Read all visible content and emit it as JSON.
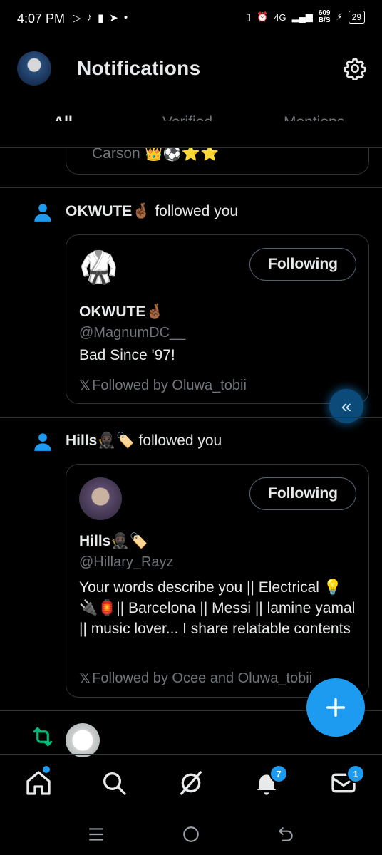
{
  "status_bar": {
    "time": "4:07 PM",
    "network": "4G",
    "speed": "609",
    "speed_unit": "B/S",
    "battery": "29"
  },
  "header": {
    "title": "Notifications"
  },
  "tabs": [
    {
      "label": "All",
      "active": true
    },
    {
      "label": "Verified",
      "active": false
    },
    {
      "label": "Mentions",
      "active": false
    }
  ],
  "partial_card": {
    "text": "Carson 👑⚽⭐⭐"
  },
  "notifications": [
    {
      "actor": "OKWUTE🤞🏾",
      "action": "followed you",
      "button": "Following",
      "name": "OKWUTE🤞🏾",
      "handle": "@MagnumDC__",
      "bio": "Bad Since '97!",
      "followed_by": "Followed by Oluwa_tobii"
    },
    {
      "actor": "Hills🥷🏿🏷️",
      "action": "followed you",
      "button": "Following",
      "name": "Hills🥷🏿🏷️",
      "handle": "@Hillary_Rayz",
      "bio": "Your words describe you || Electrical 💡🔌🏮|| Barcelona || Messi || lamine yamal || music lover... I share relatable contents",
      "followed_by": "Followed by Ocee and Oluwa_tobii"
    }
  ],
  "bottom_nav": {
    "notifications_badge": "7",
    "messages_badge": "1"
  },
  "colors": {
    "accent": "#1d9bf0",
    "background": "#000000",
    "border": "#2f3336",
    "muted": "#71767b",
    "retweet": "#00ba7c"
  },
  "icons": [
    "person-icon",
    "settings-gear-icon",
    "x-logo-icon",
    "home-icon",
    "search-icon",
    "grok-icon",
    "bell-icon",
    "mail-icon",
    "retweet-icon",
    "plus-icon",
    "double-chevron-left-icon"
  ]
}
